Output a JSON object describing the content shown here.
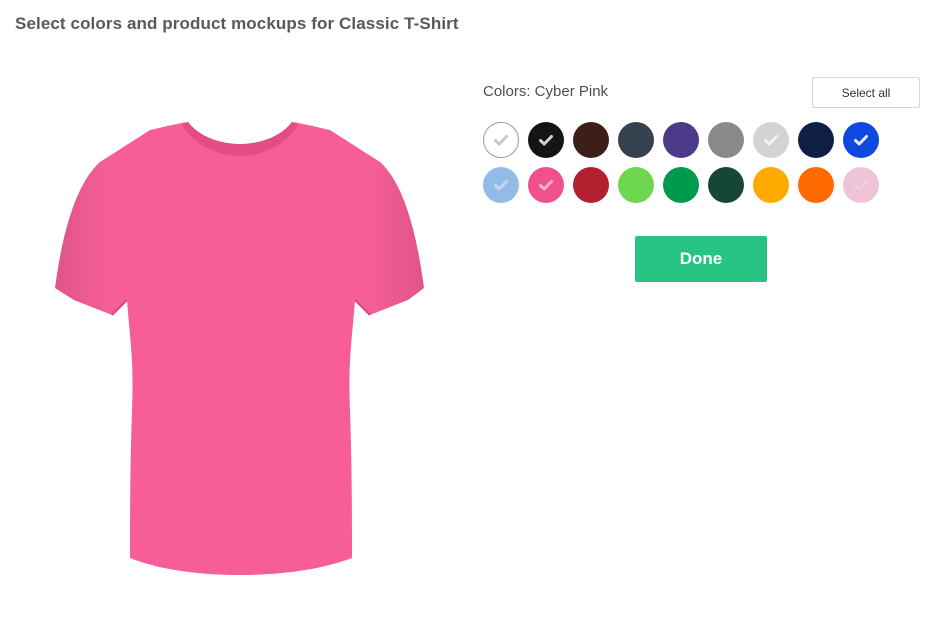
{
  "page": {
    "title": "Select colors and product mockups for Classic T-Shirt"
  },
  "preview": {
    "shirt_color": "#f75e97"
  },
  "colors": {
    "label": "Colors: Cyber Pink",
    "select_all_label": "Select all",
    "swatches": [
      {
        "name": "white",
        "hex": "#ffffff",
        "checked": true,
        "check_color": "#c8c8c8"
      },
      {
        "name": "black",
        "hex": "#141414",
        "checked": true,
        "check_color": "#d0d0d0"
      },
      {
        "name": "dark-chocolate",
        "hex": "#3d1f1a",
        "checked": false
      },
      {
        "name": "charcoal",
        "hex": "#36414e",
        "checked": false
      },
      {
        "name": "purple",
        "hex": "#4c3988",
        "checked": false
      },
      {
        "name": "gray",
        "hex": "#8a8a8a",
        "checked": false
      },
      {
        "name": "light-gray",
        "hex": "#d3d3d3",
        "checked": true,
        "check_color": "#f2f2f2"
      },
      {
        "name": "navy",
        "hex": "#0f1f45",
        "checked": false
      },
      {
        "name": "royal-blue",
        "hex": "#0f48e0",
        "checked": true,
        "check_color": "#e6ecff"
      },
      {
        "name": "light-blue",
        "hex": "#92bbe8",
        "checked": true,
        "check_color": "#c7d8ee"
      },
      {
        "name": "cyber-pink",
        "hex": "#f0508c",
        "checked": true,
        "check_color": "#e9b6c9"
      },
      {
        "name": "red",
        "hex": "#b3202e",
        "checked": false
      },
      {
        "name": "lime",
        "hex": "#6fd64f",
        "checked": false
      },
      {
        "name": "kelly-green",
        "hex": "#009a4e",
        "checked": false
      },
      {
        "name": "forest-green",
        "hex": "#164636",
        "checked": false
      },
      {
        "name": "gold",
        "hex": "#ffaa00",
        "checked": false
      },
      {
        "name": "orange",
        "hex": "#ff6a00",
        "checked": false
      },
      {
        "name": "light-pink",
        "hex": "#f0c2d7",
        "checked": true,
        "check_color": "#e9d4de"
      }
    ]
  },
  "actions": {
    "done_label": "Done"
  },
  "accent": "#27c382"
}
